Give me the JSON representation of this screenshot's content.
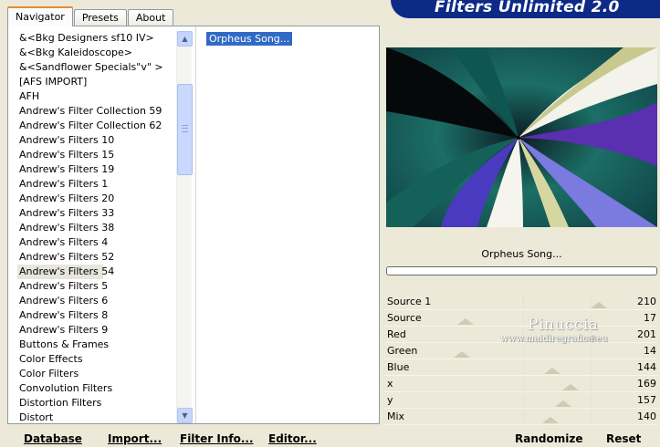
{
  "tabs": [
    "Navigator",
    "Presets",
    "About"
  ],
  "logo_text": "Filters Unlimited 2.0",
  "filter_list": [
    "&<Bkg Designers sf10 IV>",
    "&<Bkg Kaleidoscope>",
    "&<Sandflower Specials\"v\" >",
    "[AFS IMPORT]",
    "AFH",
    "Andrew's Filter Collection 59",
    "Andrew's Filter Collection 62",
    "Andrew's Filters 10",
    "Andrew's Filters 15",
    "Andrew's Filters 19",
    "Andrew's Filters 1",
    "Andrew's Filters 20",
    "Andrew's Filters 33",
    "Andrew's Filters 38",
    "Andrew's Filters 4",
    "Andrew's Filters 52",
    "Andrew's Filters 54",
    "Andrew's Filters 5",
    "Andrew's Filters 6",
    "Andrew's Filters 8",
    "Andrew's Filters 9",
    "Buttons & Frames",
    "Color Effects",
    "Color Filters",
    "Convolution Filters",
    "Distortion Filters",
    "Distort"
  ],
  "selected_filter": "Andrew's Filters 54",
  "sub_filter": "Orpheus Song...",
  "preview_label": "Orpheus Song...",
  "sliders": [
    {
      "label": "Source 1",
      "value": "210",
      "level": 0.82
    },
    {
      "label": "Source",
      "value": "17",
      "level": 0.07
    },
    {
      "label": "Red",
      "value": "201",
      "level": 0.79
    },
    {
      "label": "Green",
      "value": "14",
      "level": 0.05
    },
    {
      "label": "Blue",
      "value": "144",
      "level": 0.56
    },
    {
      "label": "x",
      "value": "169",
      "level": 0.66
    },
    {
      "label": "y",
      "value": "157",
      "level": 0.62
    },
    {
      "label": "Mix",
      "value": "140",
      "level": 0.55
    }
  ],
  "watermark": {
    "name": "Pinuccia",
    "site": "www.maidiregrafica.eu"
  },
  "buttons": {
    "database": "Database",
    "import": "Import...",
    "filter_info": "Filter Info...",
    "editor": "Editor...",
    "randomize": "Randomize",
    "reset": "Reset"
  }
}
